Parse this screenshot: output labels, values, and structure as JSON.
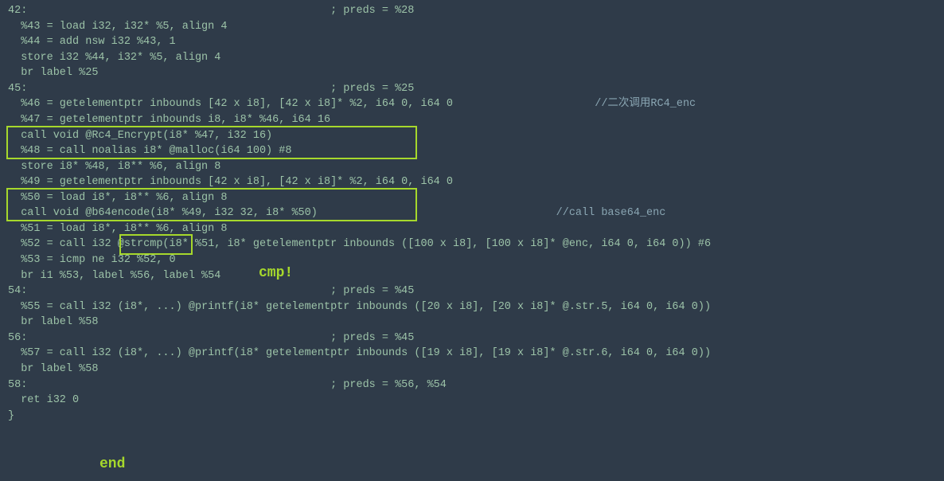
{
  "lines": {
    "l1": "42:                                               ; preds = %28",
    "l2": "  %43 = load i32, i32* %5, align 4",
    "l3": "  %44 = add nsw i32 %43, 1",
    "l4": "  store i32 %44, i32* %5, align 4",
    "l5": "  br label %25",
    "l6": "",
    "l7": "45:                                               ; preds = %25",
    "l8a": "  %46 = getelementptr inbounds [42 x i8], [42 x i8]* %2, i64 0, i64 0                      ",
    "l8b": "//二次调用RC4_enc",
    "l9": "  %47 = getelementptr inbounds i8, i8* %46, i64 16",
    "l10": "  call void @Rc4_Encrypt(i8* %47, i32 16)",
    "l11": "  %48 = call noalias i8* @malloc(i64 100) #8",
    "l12": "  store i8* %48, i8** %6, align 8",
    "l13": "  %49 = getelementptr inbounds [42 x i8], [42 x i8]* %2, i64 0, i64 0",
    "l14": "  %50 = load i8*, i8** %6, align 8",
    "l15a": "  call void @b64encode(i8* %49, i32 32, i8* %50)                                     ",
    "l15b": "//call base64_enc",
    "l16": "  %51 = load i8*, i8** %6, align 8",
    "l17": "  %52 = call i32 @strcmp(i8* %51, i8* getelementptr inbounds ([100 x i8], [100 x i8]* @enc, i64 0, i64 0)) #6",
    "l18": "  %53 = icmp ne i32 %52, 0",
    "l19": "  br i1 %53, label %56, label %54",
    "l20": "",
    "l21": "54:                                               ; preds = %45",
    "l22": "  %55 = call i32 (i8*, ...) @printf(i8* getelementptr inbounds ([20 x i8], [20 x i8]* @.str.5, i64 0, i64 0))",
    "l23": "  br label %58",
    "l24": "",
    "l25": "56:                                               ; preds = %45",
    "l26": "  %57 = call i32 (i8*, ...) @printf(i8* getelementptr inbounds ([19 x i8], [19 x i8]* @.str.6, i64 0, i64 0))",
    "l27": "  br label %58",
    "l28": "",
    "l29": "58:                                               ; preds = %56, %54",
    "l30": "  ret i32 0",
    "l31": "}"
  },
  "annotations": {
    "cmp": "cmp!",
    "end": "end"
  }
}
